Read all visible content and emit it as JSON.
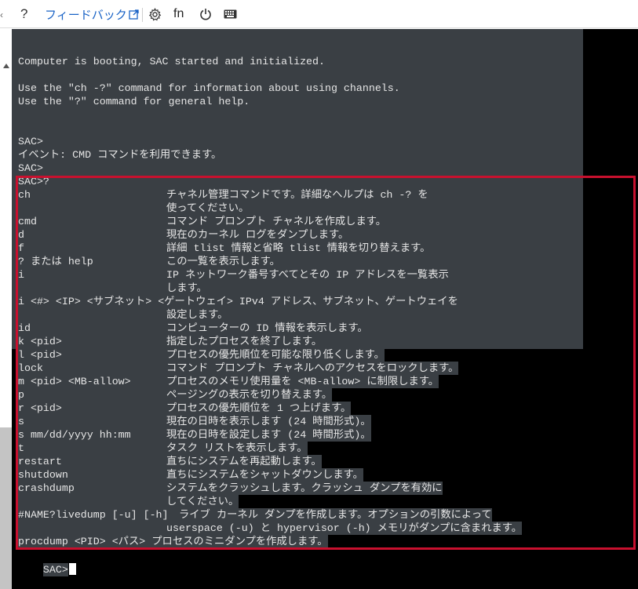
{
  "toolbar": {
    "help_label": "?",
    "feedback_label": "フィードバック",
    "fn_label": "fn",
    "icons": [
      "chevron-left-icon",
      "external-link-icon",
      "gear-icon",
      "power-icon",
      "keyboard-icon"
    ]
  },
  "console": {
    "boot_line": "Computer is booting, SAC started and initialized.",
    "help_line1": "Use the \"ch -?\" command for information about using channels.",
    "help_line2": "Use the \"?\" command for general help.",
    "prompt1": "SAC>",
    "event_line": "イベント: CMD コマンドを利用できます。",
    "prompt2": "SAC>",
    "prompt_query": "SAC>?",
    "commands": [
      {
        "cmd": "ch",
        "desc": "チャネル管理コマンドです。詳細なヘルプは ch -? を"
      },
      {
        "cmd": "",
        "desc": "使ってください。"
      },
      {
        "cmd": "cmd",
        "desc": "コマンド プロンプト チャネルを作成します。"
      },
      {
        "cmd": "d",
        "desc": "現在のカーネル ログをダンプします。"
      },
      {
        "cmd": "f",
        "desc": "詳細 tlist 情報と省略 tlist 情報を切り替えます。"
      },
      {
        "cmd": "? または help",
        "desc": "この一覧を表示します。"
      },
      {
        "cmd": "i",
        "desc": "IP ネットワーク番号すべてとその IP アドレスを一覧表示"
      },
      {
        "cmd": "",
        "desc": "します。"
      },
      {
        "cmd": "i <#> <IP> <サブネット> <ゲートウェイ> IPv4 アドレス、サブネット、ゲートウェイを",
        "desc": ""
      },
      {
        "cmd": "",
        "desc": "設定します。"
      },
      {
        "cmd": "id",
        "desc": "コンピューターの ID 情報を表示します。"
      },
      {
        "cmd": "k <pid>",
        "desc": "指定したプロセスを終了します。"
      },
      {
        "cmd": "l <pid>",
        "desc": "プロセスの優先順位を可能な限り低くします。"
      },
      {
        "cmd": "lock",
        "desc": "コマンド プロンプト チャネルへのアクセスをロックします。"
      },
      {
        "cmd": "m <pid> <MB-allow>",
        "desc": "プロセスのメモリ使用量を <MB-allow> に制限します。"
      },
      {
        "cmd": "p",
        "desc": "ページングの表示を切り替えます。"
      },
      {
        "cmd": "r <pid>",
        "desc": "プロセスの優先順位を 1 つ上げます。"
      },
      {
        "cmd": "s",
        "desc": "現在の日時を表示します (24 時間形式)。"
      },
      {
        "cmd": "s mm/dd/yyyy hh:mm",
        "desc": "現在の日時を設定します (24 時間形式)。"
      },
      {
        "cmd": "t",
        "desc": "タスク リストを表示します。"
      },
      {
        "cmd": "restart",
        "desc": "直ちにシステムを再起動します。"
      },
      {
        "cmd": "shutdown",
        "desc": "直ちにシステムをシャットダウンします。"
      },
      {
        "cmd": "crashdump",
        "desc": "システムをクラッシュします。クラッシュ ダンプを有効に"
      },
      {
        "cmd": "",
        "desc": "してください。"
      },
      {
        "cmd": "#NAME?livedump [-u] [-h]",
        "desc": "  ライブ カーネル ダンプを作成します。オプションの引数によって"
      },
      {
        "cmd": "",
        "desc": "userspace (-u) と hypervisor (-h) メモリがダンプに含まれます。"
      },
      {
        "cmd": "procdump <PID> <パス> プロセスのミニダンプを作成します。",
        "desc": ""
      }
    ],
    "final_prompt": "SAC>"
  },
  "colors": {
    "console_bg": "#000000",
    "selection_bg": "#3a3f44",
    "highlight_border": "#c8102e",
    "link": "#1a63c6"
  }
}
